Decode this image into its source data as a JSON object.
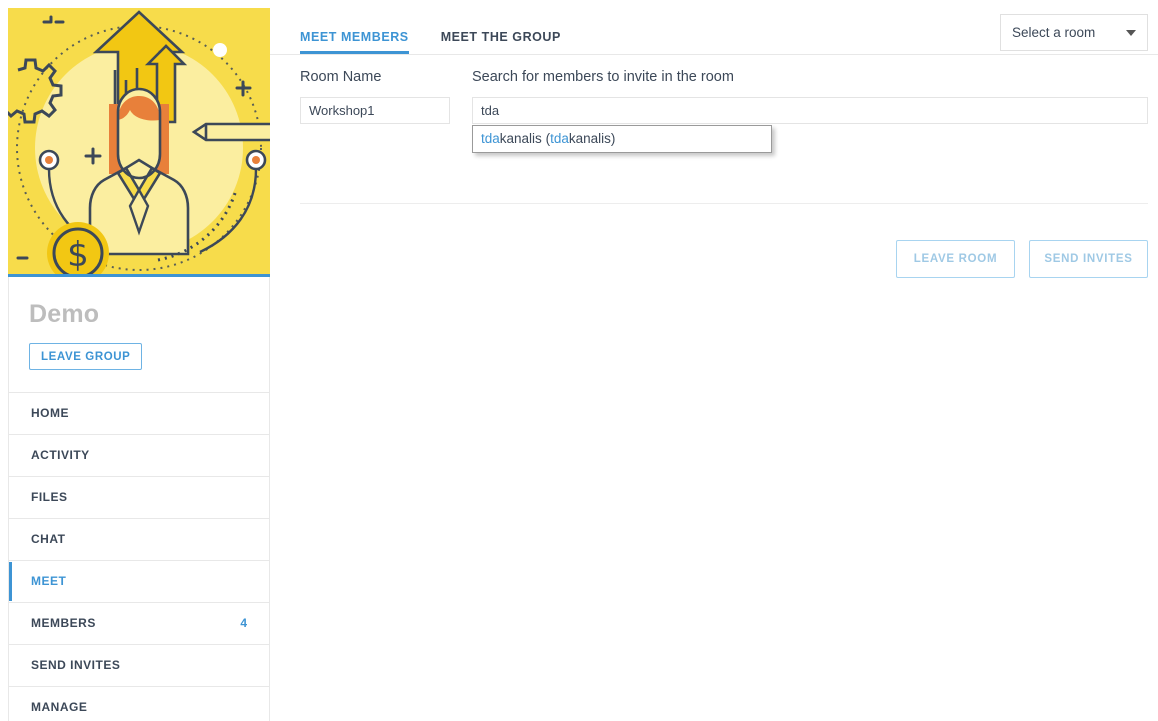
{
  "sidebar": {
    "hero_alt": "group-illustration",
    "group_name": "Demo",
    "leave_group_label": "LEAVE GROUP",
    "items": [
      {
        "label": "HOME",
        "badge": "",
        "active": false
      },
      {
        "label": "ACTIVITY",
        "badge": "",
        "active": false
      },
      {
        "label": "FILES",
        "badge": "",
        "active": false
      },
      {
        "label": "CHAT",
        "badge": "",
        "active": false
      },
      {
        "label": "MEET",
        "badge": "",
        "active": true
      },
      {
        "label": "MEMBERS",
        "badge": "4",
        "active": false
      },
      {
        "label": "SEND INVITES",
        "badge": "",
        "active": false
      },
      {
        "label": "MANAGE",
        "badge": "",
        "active": false
      }
    ]
  },
  "main": {
    "tabs": [
      {
        "label": "MEET MEMBERS",
        "active": true
      },
      {
        "label": "MEET THE GROUP",
        "active": false
      }
    ],
    "room_select": {
      "value": "Select a room",
      "icon": "chevron-down-icon"
    },
    "room_name": {
      "label": "Room Name",
      "value": "Workshop1",
      "placeholder": "Room Name"
    },
    "member_search": {
      "label": "Search for members to invite in the room",
      "value": "tda",
      "placeholder": "Search for members",
      "suggestion": {
        "match": "tda",
        "rest": "kanalis",
        "open_paren": " (",
        "match2": "tda",
        "rest2": "kanalis",
        "close_paren": ")",
        "full_text": "tdakanalis (tdakanalis)"
      }
    },
    "buttons": [
      {
        "label": "LEAVE ROOM",
        "disabled": true
      },
      {
        "label": "SEND INVITES",
        "disabled": true
      }
    ]
  },
  "colors": {
    "accent_blue": "#3d94d4",
    "hero_yellow": "#f7dc4b",
    "text_dark": "#3c4858",
    "disabled_blue": "#9fc9e5"
  }
}
